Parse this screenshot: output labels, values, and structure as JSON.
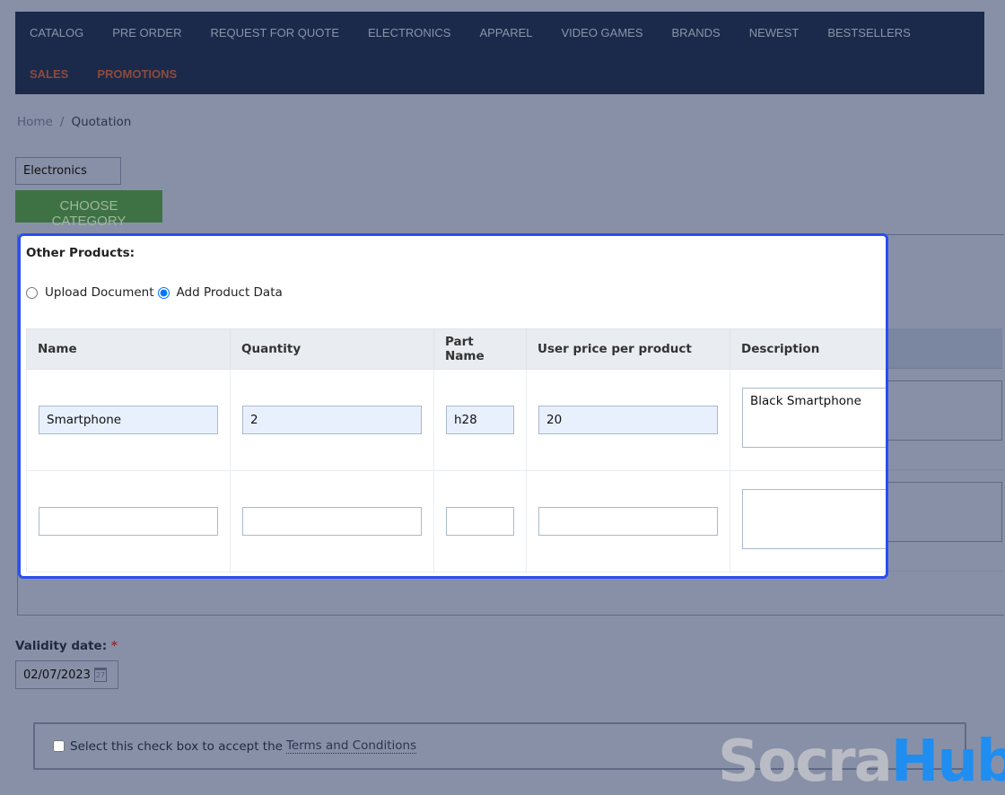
{
  "nav": {
    "row1": [
      "CATALOG",
      "PRE ORDER",
      "REQUEST FOR QUOTE",
      "ELECTRONICS",
      "APPAREL",
      "VIDEO GAMES",
      "BRANDS",
      "NEWEST",
      "BESTSELLERS"
    ],
    "row2": [
      "SALES",
      "PROMOTIONS"
    ]
  },
  "breadcrumb": {
    "home": "Home",
    "sep": "/",
    "current": "Quotation"
  },
  "category": {
    "selected": "Electronics",
    "button": "CHOOSE CATEGORY"
  },
  "other_products": {
    "title": "Other Products:",
    "radio_upload": "Upload Document",
    "radio_add": "Add Product Data",
    "columns": [
      "Name",
      "Quantity",
      "Part Name",
      "User price per product",
      "Description"
    ],
    "rows": [
      {
        "name": "Smartphone",
        "quantity": "2",
        "part": "h28",
        "price": "20",
        "description": "Black Smartphone"
      },
      {
        "name": "",
        "quantity": "",
        "part": "",
        "price": "",
        "description": ""
      }
    ]
  },
  "validity": {
    "label": "Validity date:",
    "required": "*",
    "value": "02/07/2023",
    "cal_day": "27"
  },
  "terms": {
    "text": "Select this check box to accept the",
    "link": "Terms and Conditions"
  },
  "watermark": {
    "a": "Socra",
    "b": "Hub"
  },
  "colors": {
    "nav": "#1b2a4a",
    "highlight": "#2a4ef0",
    "button": "#3e7244"
  }
}
